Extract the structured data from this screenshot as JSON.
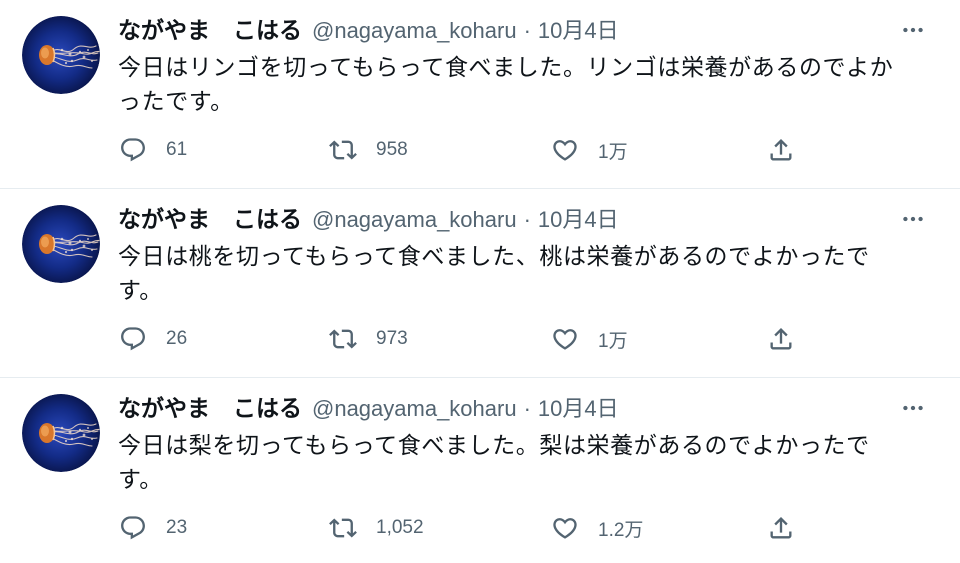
{
  "tweets": [
    {
      "author": {
        "name": "ながやま　こはる",
        "handle": "@nagayama_koharu"
      },
      "separator": "·",
      "date": "10月4日",
      "text_lines": [
        "今日はリンゴを切ってもらって食べました。リンゴは栄養があるのでよか",
        "ったです。"
      ],
      "actions": {
        "replies": "61",
        "retweets": "958",
        "likes": "1万"
      }
    },
    {
      "author": {
        "name": "ながやま　こはる",
        "handle": "@nagayama_koharu"
      },
      "separator": "·",
      "date": "10月4日",
      "text_lines": [
        "今日は桃を切ってもらって食べました、桃は栄養があるのでよかったで",
        "す。"
      ],
      "actions": {
        "replies": "26",
        "retweets": "973",
        "likes": "1万"
      }
    },
    {
      "author": {
        "name": "ながやま　こはる",
        "handle": "@nagayama_koharu"
      },
      "separator": "·",
      "date": "10月4日",
      "text_lines": [
        "今日は梨を切ってもらって食べました。梨は栄養があるのでよかったで",
        "す。"
      ],
      "actions": {
        "replies": "23",
        "retweets": "1,052",
        "likes": "1.2万"
      }
    }
  ],
  "icons": {
    "reply": "reply-icon",
    "retweet": "retweet-icon",
    "like": "heart-icon",
    "share": "share-icon",
    "more": "more-icon"
  },
  "colors": {
    "text": "#0f1419",
    "secondary": "#536471",
    "divider": "#e6ecf0",
    "avatar_background": "#132b86",
    "jellyfish": "#d9772b"
  }
}
